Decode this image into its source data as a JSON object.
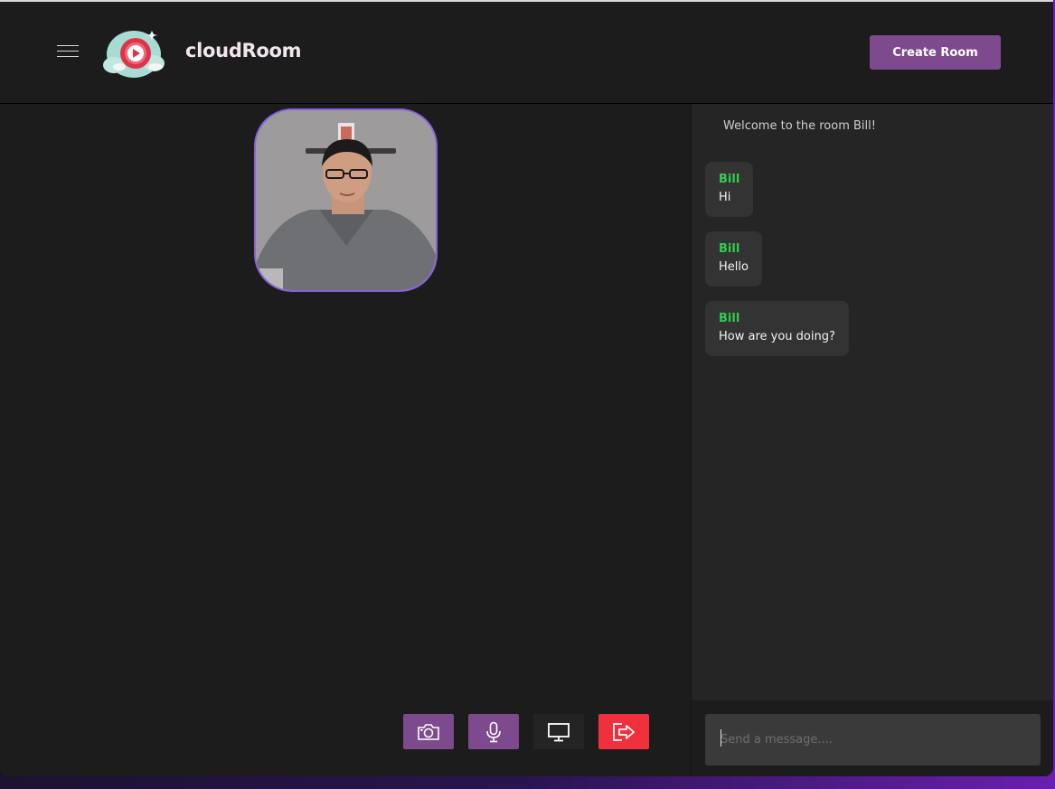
{
  "header": {
    "brand": "cloudRoom",
    "create_button": "Create Room"
  },
  "colors": {
    "accent": "#7d4a8e",
    "leave": "#f0303d",
    "sender": "#2fce4e",
    "video_border": "#8b5fe0"
  },
  "video": {
    "icon": "participant-video"
  },
  "controls": [
    {
      "name": "camera-icon"
    },
    {
      "name": "microphone-icon"
    },
    {
      "name": "screen-share-icon"
    },
    {
      "name": "leave-room-icon"
    }
  ],
  "chat": {
    "welcome": "Welcome to the room Bill!",
    "messages": [
      {
        "sender": "Bill",
        "text": "Hi"
      },
      {
        "sender": "Bill",
        "text": "Hello"
      },
      {
        "sender": "Bill",
        "text": "How are you doing?"
      }
    ],
    "input_placeholder": "Send a message...."
  }
}
